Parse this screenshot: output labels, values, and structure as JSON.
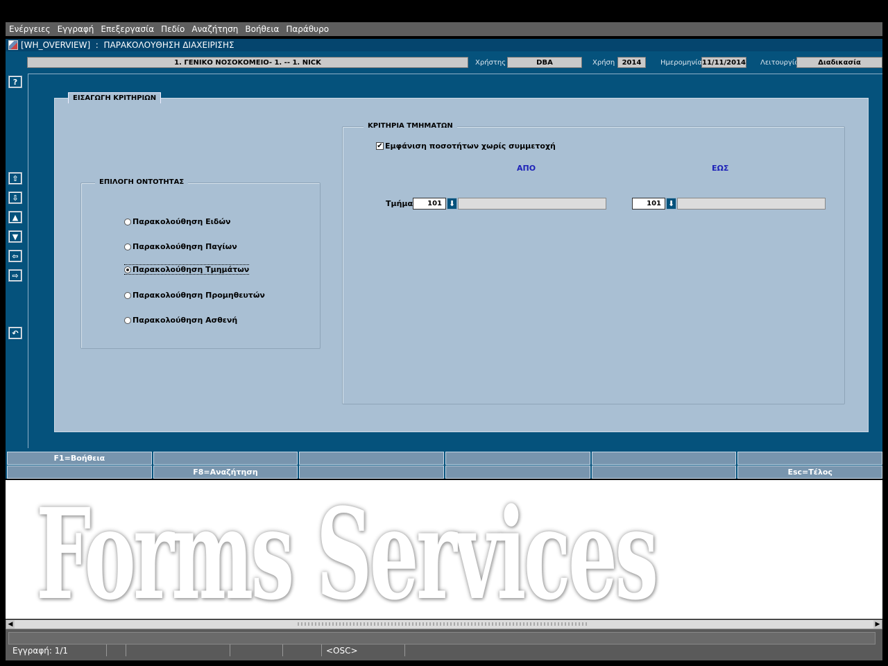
{
  "menu": [
    "Ενέργειες",
    "Εγγραφή",
    "Επεξεργασία",
    "Πεδίο",
    "Αναζήτηση",
    "Βοήθεια",
    "Παράθυρο"
  ],
  "window": {
    "title": "[WH_OVERVIEW]  :  ΠΑΡΑΚΟΛΟΥΘΗΣΗ ΔΙΑΧΕΙΡΙΣΗΣ"
  },
  "header": {
    "organization": "1. ΓΕΝΙΚΟ ΝΟΣΟΚΟΜΕΙΟ- 1. -- 1. NICK",
    "user_label": "Χρήστης",
    "user_value": "DBA",
    "year_label": "Χρήση",
    "year_value": "2014",
    "date_label": "Ημερομηνία",
    "date_value": "11/11/2014",
    "function_label": "Λειτουργία",
    "function_value": "Διαδικασία"
  },
  "toolbar_icons": [
    "help-icon",
    "first-record-icon",
    "last-record-icon",
    "previous-record-icon",
    "next-record-icon",
    "previous-block-icon",
    "next-block-icon",
    "exit-icon"
  ],
  "panel": {
    "title": "ΕΙΣΑΓΩΓΗ ΚΡΙΤΗΡΙΩΝ",
    "entity_group": {
      "title": "ΕΠΙΛΟΓΗ ΟΝΤΟΤΗΤΑΣ",
      "options": [
        {
          "label": "Παρακολούθηση Ειδών",
          "selected": false
        },
        {
          "label": "Παρακολούθηση Παγίων",
          "selected": false
        },
        {
          "label": "Παρακολούθηση Τμημάτων",
          "selected": true
        },
        {
          "label": "Παρακολούθηση Προμηθευτών",
          "selected": false
        },
        {
          "label": "Παρακολούθηση Ασθενή",
          "selected": false
        }
      ]
    },
    "criteria_group": {
      "title": "ΚΡΙΤΗΡΙΑ ΤΜΗΜΑΤΩΝ",
      "checkbox_label": "Εμφάνιση ποσοτήτων χωρίς συμμετοχή",
      "checkbox_checked": true,
      "from_label": "ΑΠΟ",
      "to_label": "ΕΩΣ",
      "department_label": "Τμήμα",
      "from_value": "101",
      "to_value": "101",
      "from_description": "",
      "to_description": ""
    }
  },
  "function_keys": {
    "row1": [
      "F1=Βοήθεια",
      "",
      "",
      "",
      "",
      ""
    ],
    "row2": [
      "",
      "F8=Αναζήτηση",
      "",
      "",
      "",
      "Esc=Τέλος"
    ]
  },
  "watermark": "Forms Services",
  "status": {
    "record": "Εγγραφή: 1/1",
    "mode": "<OSC>"
  },
  "colors": {
    "workarea": "#05527c",
    "panel": "#a9bfd3",
    "accent_text": "#1e22b8",
    "function_key": "#7895ae"
  }
}
